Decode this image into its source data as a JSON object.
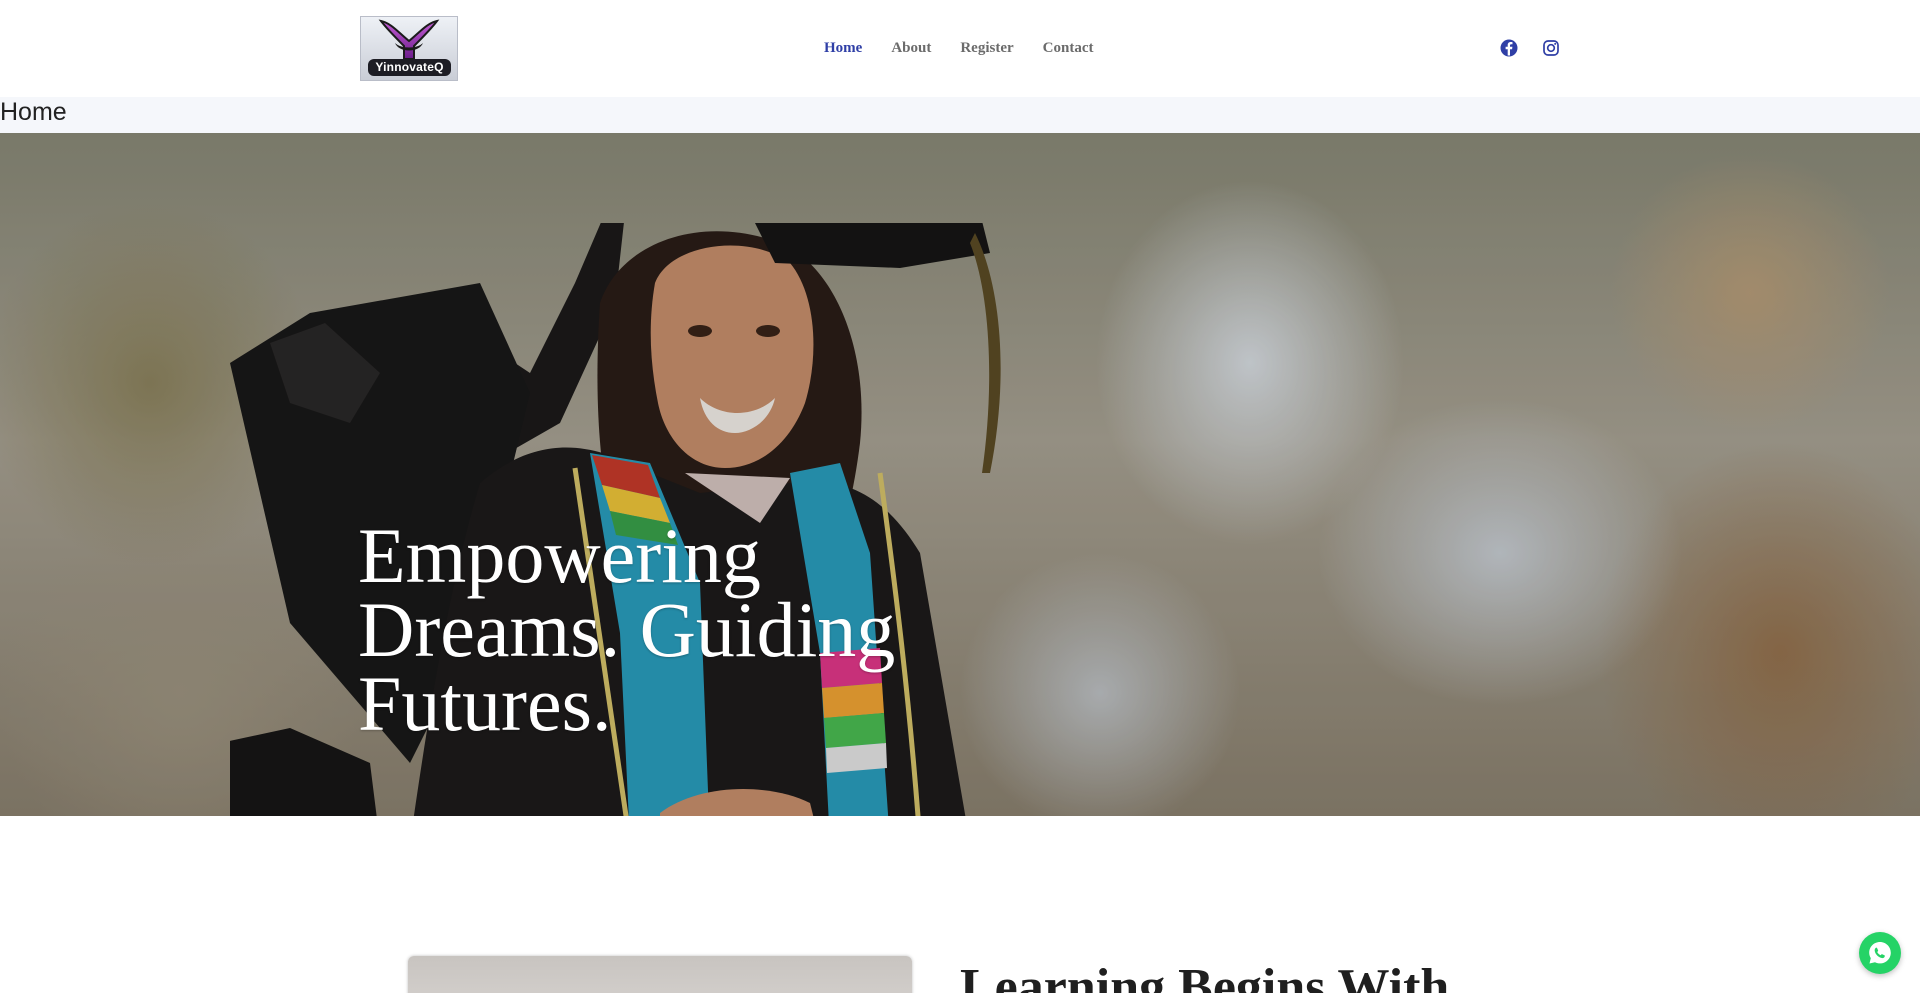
{
  "header": {
    "logo_text": "YinnovateQ",
    "nav": [
      {
        "label": "Home",
        "active": true
      },
      {
        "label": "About",
        "active": false
      },
      {
        "label": "Register",
        "active": false
      },
      {
        "label": "Contact",
        "active": false
      }
    ],
    "social": [
      {
        "icon": "facebook-icon"
      },
      {
        "icon": "instagram-icon"
      }
    ]
  },
  "breadcrumb": {
    "title": "Home"
  },
  "hero": {
    "title": "Empowering Dreams. Guiding Futures.",
    "image": "graduate-photo"
  },
  "intro": {
    "title": "Learning Begins With"
  },
  "floating": {
    "icon": "whatsapp-icon"
  },
  "colors": {
    "nav_active": "#2f3fa6",
    "nav_default": "#6b6b6b",
    "breadcrumb_bg": "#f5f7fb",
    "whatsapp": "#25d366"
  }
}
